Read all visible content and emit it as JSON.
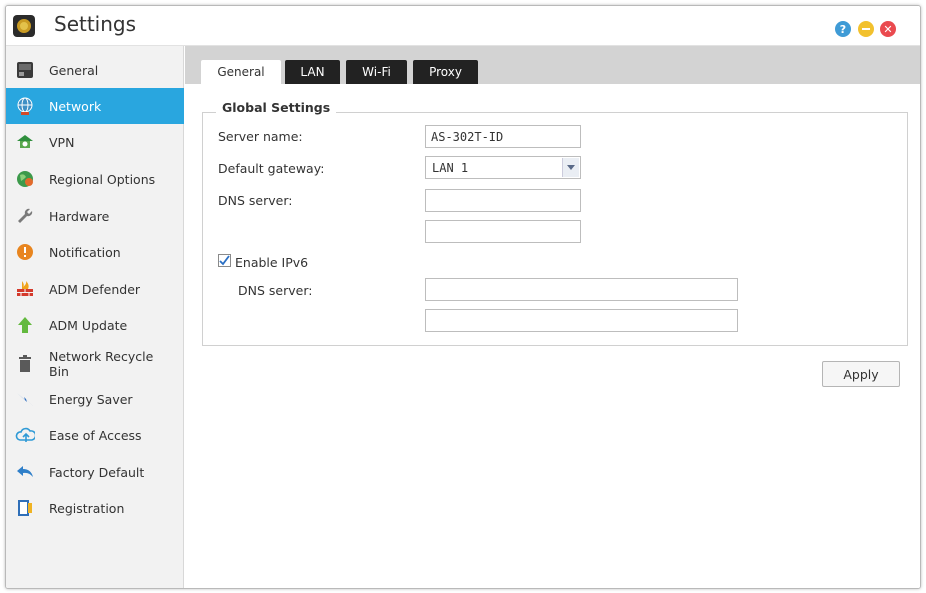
{
  "window": {
    "title": "Settings"
  },
  "sidebar": {
    "items": [
      {
        "label": "General",
        "icon": "general-icon"
      },
      {
        "label": "Network",
        "icon": "network-globe-icon"
      },
      {
        "label": "VPN",
        "icon": "vpn-icon"
      },
      {
        "label": "Regional Options",
        "icon": "regional-globe-icon"
      },
      {
        "label": "Hardware",
        "icon": "wrench-icon"
      },
      {
        "label": "Notification",
        "icon": "alert-icon"
      },
      {
        "label": "ADM Defender",
        "icon": "firewall-icon"
      },
      {
        "label": "ADM Update",
        "icon": "update-arrow-icon"
      },
      {
        "label": "Network Recycle Bin",
        "icon": "trash-icon"
      },
      {
        "label": "Energy Saver",
        "icon": "lightning-icon"
      },
      {
        "label": "Ease of Access",
        "icon": "cloud-icon"
      },
      {
        "label": "Factory Default",
        "icon": "undo-arrow-icon"
      },
      {
        "label": "Registration",
        "icon": "registration-icon"
      }
    ],
    "active_index": 1
  },
  "tabs": [
    {
      "label": "General"
    },
    {
      "label": "LAN"
    },
    {
      "label": "Wi-Fi"
    },
    {
      "label": "Proxy"
    }
  ],
  "global_settings": {
    "legend": "Global Settings",
    "server_name_label": "Server name:",
    "server_name_value": "AS-302T-ID",
    "default_gateway_label": "Default gateway:",
    "default_gateway_value": "LAN 1",
    "dns_label": "DNS server:",
    "dns_value_1": "",
    "dns_value_2": "",
    "ipv6_label": "Enable IPv6",
    "ipv6_enabled": true,
    "ipv6_dns_label": "DNS server:",
    "ipv6_dns_value_1": "",
    "ipv6_dns_value_2": ""
  },
  "actions": {
    "apply_label": "Apply"
  },
  "colors": {
    "accent": "#29a6df",
    "tab_dark": "#222222",
    "help": "#3f9bd6",
    "minimize": "#f2c12e",
    "close": "#ea4a4f"
  }
}
